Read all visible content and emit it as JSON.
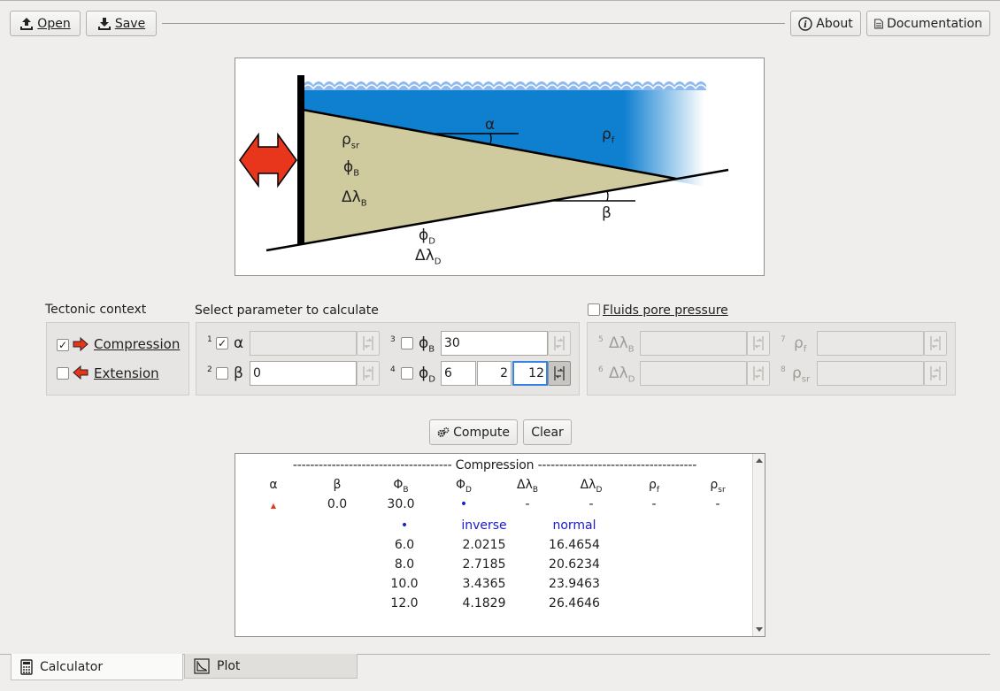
{
  "toolbar": {
    "open_label": "Open",
    "save_label": "Save",
    "about_label": "About",
    "documentation_label": "Documentation"
  },
  "diagram": {
    "rho_sr": "ρ",
    "rho_sr_sub": "sr",
    "phi_b": "ϕ",
    "phi_b_sub": "B",
    "dl_b": "Δλ",
    "dl_b_sub": "B",
    "alpha": "α",
    "rho_f": "ρ",
    "rho_f_sub": "f",
    "beta": "β",
    "phi_d": "ϕ",
    "phi_d_sub": "D",
    "dl_d": "Δλ",
    "dl_d_sub": "D"
  },
  "tectonic": {
    "title": "Tectonic context",
    "compression_label": "Compression",
    "compression_checked": true,
    "extension_label": "Extension",
    "extension_checked": false
  },
  "select": {
    "title": "Select parameter to calculate",
    "p1": {
      "num": "1",
      "sym": "α",
      "value": "",
      "checked": true
    },
    "p2": {
      "num": "2",
      "sym": "β",
      "value": "0",
      "checked": false
    },
    "p3": {
      "num": "3",
      "sym": "ϕ",
      "sub": "B",
      "value": "30",
      "checked": false
    },
    "p4": {
      "num": "4",
      "sym": "ϕ",
      "sub": "D",
      "v1": "6",
      "v2": "2",
      "v3": "12",
      "checked": false
    }
  },
  "fluids": {
    "title": "Fluids pore pressure",
    "checked": false,
    "p5": {
      "num": "5",
      "sym": "Δλ",
      "sub": "B"
    },
    "p6": {
      "num": "6",
      "sym": "Δλ",
      "sub": "D"
    },
    "p7": {
      "num": "7",
      "sym": "ρ",
      "sub": "f"
    },
    "p8": {
      "num": "8",
      "sym": "ρ",
      "sub": "sr"
    }
  },
  "actions": {
    "compute_label": "Compute",
    "clear_label": "Clear"
  },
  "results": {
    "header_line": "------------------------------------- Compression -------------------------------------",
    "columns": [
      {
        "s": "α",
        "sub": ""
      },
      {
        "s": "β",
        "sub": ""
      },
      {
        "s": "Φ",
        "sub": "B"
      },
      {
        "s": "Φ",
        "sub": "D"
      },
      {
        "s": "Δλ",
        "sub": "B"
      },
      {
        "s": "Δλ",
        "sub": "D"
      },
      {
        "s": "ρ",
        "sub": "f"
      },
      {
        "s": "ρ",
        "sub": "sr"
      }
    ],
    "values": [
      "▲",
      "0.0",
      "30.0",
      "•",
      "-",
      "-",
      "-",
      "-"
    ],
    "sub_header": {
      "marker": "•",
      "inverse": "inverse",
      "normal": "normal"
    },
    "rows": [
      [
        "6.0",
        "2.0215",
        "16.4654"
      ],
      [
        "8.0",
        "2.7185",
        "20.6234"
      ],
      [
        "10.0",
        "3.4365",
        "23.9463"
      ],
      [
        "12.0",
        "4.1829",
        "26.4646"
      ]
    ]
  },
  "tabs": {
    "calculator_label": "Calculator",
    "plot_label": "Plot"
  },
  "colors": {
    "accent": "#3584e4",
    "compression_arrow": "#e8361c",
    "water": "#0f7fd0",
    "sediment": "#d0cb9e",
    "result_blue": "#1a1ad0"
  }
}
